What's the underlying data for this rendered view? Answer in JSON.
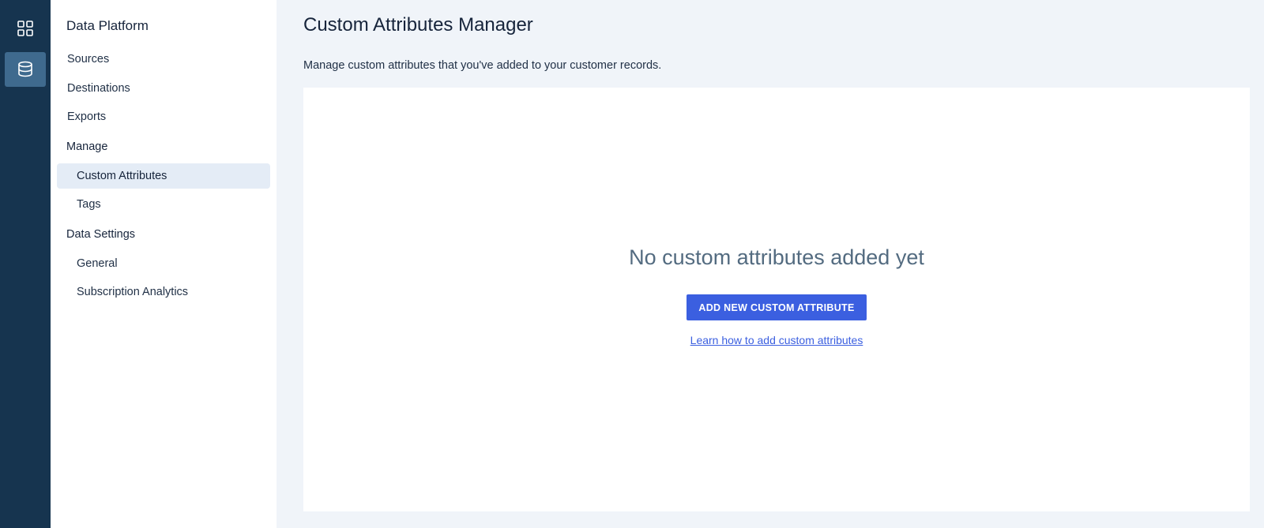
{
  "rail": {
    "items": [
      {
        "icon": "grid-icon",
        "active": false
      },
      {
        "icon": "database-icon",
        "active": true
      }
    ]
  },
  "sidebar": {
    "title": "Data Platform",
    "top_items": [
      {
        "label": "Sources"
      },
      {
        "label": "Destinations"
      },
      {
        "label": "Exports"
      }
    ],
    "sections": [
      {
        "label": "Manage",
        "items": [
          {
            "label": "Custom Attributes",
            "active": true
          },
          {
            "label": "Tags",
            "active": false
          }
        ]
      },
      {
        "label": "Data Settings",
        "items": [
          {
            "label": "General",
            "active": false
          },
          {
            "label": "Subscription Analytics",
            "active": false
          }
        ]
      }
    ]
  },
  "main": {
    "title": "Custom Attributes Manager",
    "description": "Manage custom attributes that you've added to your customer records.",
    "empty_state": {
      "heading": "No custom attributes added yet",
      "button_label": "ADD NEW CUSTOM ATTRIBUTE",
      "link_label": "Learn how to add custom attributes"
    }
  },
  "colors": {
    "rail_bg": "#16344f",
    "rail_active": "#3f6a8e",
    "accent": "#3b5fe0",
    "page_bg": "#f0f4f9",
    "active_nav_bg": "#e4ecf6"
  }
}
